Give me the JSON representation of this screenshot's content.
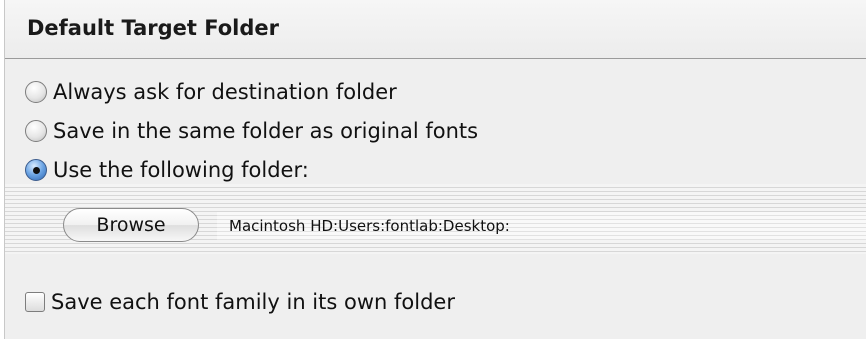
{
  "section": {
    "title": "Default Target Folder"
  },
  "options": [
    {
      "label": "Always ask for destination folder",
      "selected": false
    },
    {
      "label": "Save in the same folder as original fonts",
      "selected": false
    },
    {
      "label": "Use the following folder:",
      "selected": true
    }
  ],
  "folder": {
    "browse_label": "Browse",
    "path": "Macintosh HD:Users:fontlab:Desktop:"
  },
  "family_option": {
    "label": "Save each font family in its own folder",
    "checked": false
  },
  "colors": {
    "radio_selected": "#2d65b1",
    "panel_bg": "#efefef"
  }
}
